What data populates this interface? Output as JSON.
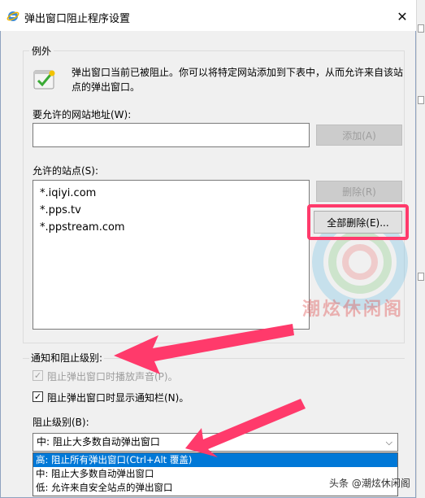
{
  "window": {
    "title": "弹出窗口阻止程序设置",
    "close_label": "✕"
  },
  "exceptions": {
    "legend": "例外",
    "description": "弹出窗口当前已被阻止。你可以将特定网站添加到下表中，从而允许来自该站点的弹出窗口。",
    "address_label": "要允许的网站地址(W):",
    "address_value": "",
    "add_button": "添加(A)",
    "allowed_label": "允许的站点(S):",
    "allowed_sites": [
      "*.iqiyi.com",
      "*.pps.tv",
      "*.ppstream.com"
    ],
    "remove_button": "删除(R)",
    "remove_all_button": "全部删除(E)..."
  },
  "notifications": {
    "heading": "通知和阻止级别:",
    "play_sound_label": "阻止弹出窗口时播放声音(P)。",
    "play_sound_checked": true,
    "play_sound_enabled": false,
    "show_bar_label": "阻止弹出窗口时显示通知栏(N)。",
    "show_bar_checked": true,
    "level_label": "阻止级别(B):",
    "level_selected": "中: 阻止大多数自动弹出窗口",
    "level_options": [
      "高: 阻止所有弹出窗口(Ctrl+Alt 覆盖)",
      "中: 阻止大多数自动弹出窗口",
      "低: 允许来自安全站点的弹出窗口"
    ],
    "highlighted_option_index": 0
  },
  "watermark": {
    "text": "潮炫休闲阁"
  },
  "credit": {
    "text": "头条 @潮炫休闲阁"
  },
  "colors": {
    "annotation": "#ff3a6b",
    "selection": "#0078d7"
  },
  "icons": {
    "title": "ie-globe-icon",
    "info": "shield-check-icon",
    "dropdown": "chevron-down-icon"
  }
}
